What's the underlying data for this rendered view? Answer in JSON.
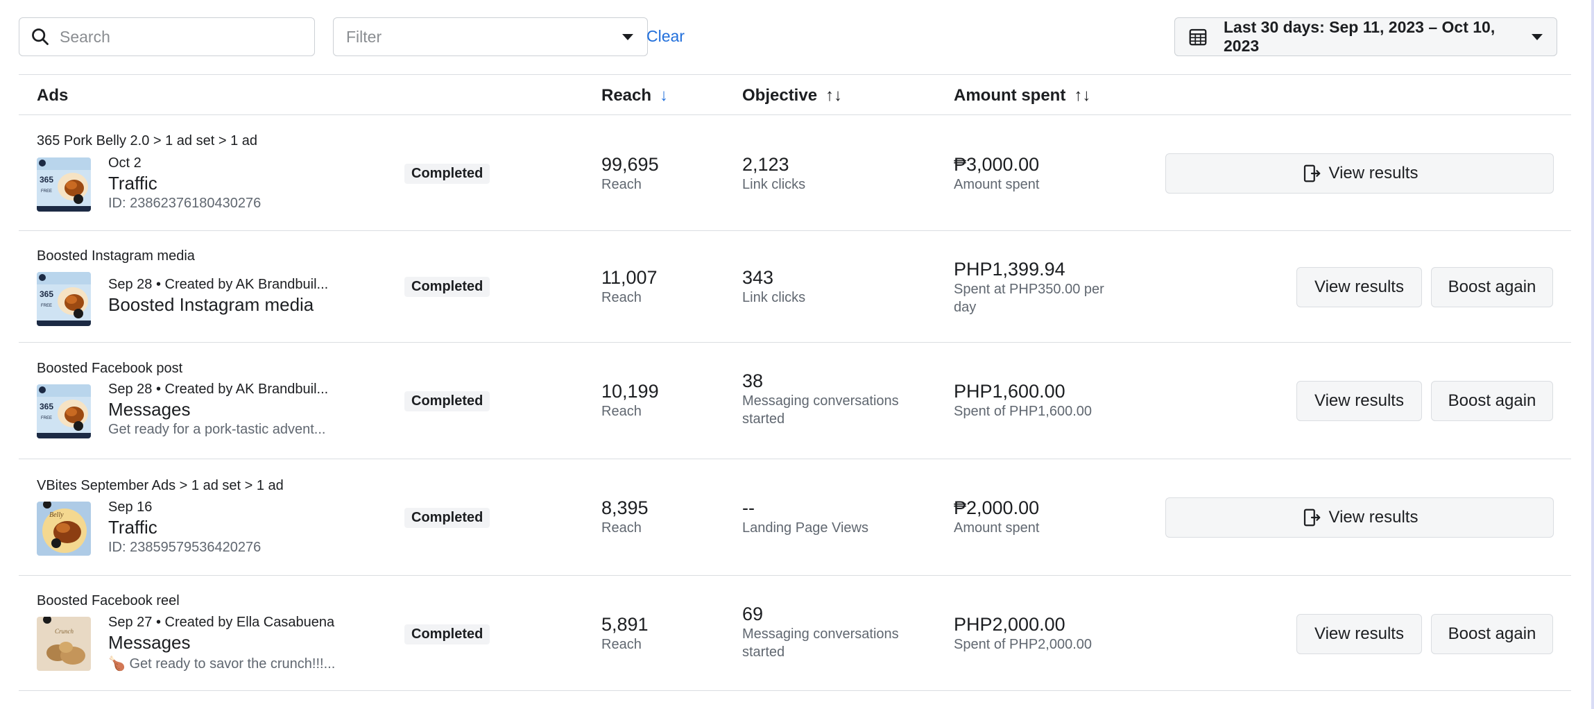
{
  "toolbar": {
    "search_placeholder": "Search",
    "filter_placeholder": "Filter",
    "clear_label": "Clear",
    "date_range": "Last 30 days: Sep 11, 2023 – Oct 10, 2023"
  },
  "table": {
    "headers": {
      "ads": "Ads",
      "reach": "Reach",
      "objective": "Objective",
      "amount_spent": "Amount spent"
    },
    "rows": [
      {
        "breadcrumb": "365 Pork Belly 2.0 > 1 ad set > 1 ad",
        "date": "Oct 2",
        "name": "Traffic",
        "sub": "ID: 23862376180430276",
        "status": "Completed",
        "reach": "99,695",
        "reach_label": "Reach",
        "objective": "2,123",
        "objective_label": "Link clicks",
        "spent": "₱3,000.00",
        "spent_label": "Amount spent",
        "view_results": "View results"
      },
      {
        "breadcrumb": "Boosted Instagram media",
        "date": "Sep 28 • Created by AK Brandbuil...",
        "name": "Boosted Instagram media",
        "status": "Completed",
        "reach": "11,007",
        "reach_label": "Reach",
        "objective": "343",
        "objective_label": "Link clicks",
        "spent": "PHP1,399.94",
        "spent_label_1": "Spent at PHP350.00 per",
        "spent_label_2": "day",
        "view_results": "View results",
        "boost_again": "Boost again"
      },
      {
        "breadcrumb": "Boosted Facebook post",
        "date": "Sep 28 • Created by AK Brandbuil...",
        "name": "Messages",
        "sub": "Get ready for a pork-tastic advent...",
        "status": "Completed",
        "reach": "10,199",
        "reach_label": "Reach",
        "objective": "38",
        "objective_label_1": "Messaging conversations",
        "objective_label_2": "started",
        "spent": "PHP1,600.00",
        "spent_label": "Spent of PHP1,600.00",
        "view_results": "View results",
        "boost_again": "Boost again"
      },
      {
        "breadcrumb": "VBites September Ads > 1 ad set > 1 ad",
        "date": "Sep 16",
        "name": "Traffic",
        "sub": "ID: 23859579536420276",
        "status": "Completed",
        "reach": "8,395",
        "reach_label": "Reach",
        "objective": "--",
        "objective_label": "Landing Page Views",
        "spent": "₱2,000.00",
        "spent_label": "Amount spent",
        "view_results": "View results"
      },
      {
        "breadcrumb": "Boosted Facebook reel",
        "date": "Sep 27 • Created by Ella Casabuena",
        "name": "Messages",
        "sub": "🍗 Get ready to savor the crunch!!!...",
        "status": "Completed",
        "reach": "5,891",
        "reach_label": "Reach",
        "objective": "69",
        "objective_label_1": "Messaging conversations",
        "objective_label_2": "started",
        "spent": "PHP2,000.00",
        "spent_label": "Spent of PHP2,000.00",
        "view_results": "View results",
        "boost_again": "Boost again"
      }
    ]
  },
  "thumb_text": "365",
  "thumb_tag": "FREE",
  "colors": {
    "accent": "#216fdb",
    "border": "#dadde1",
    "muted": "#606770"
  }
}
